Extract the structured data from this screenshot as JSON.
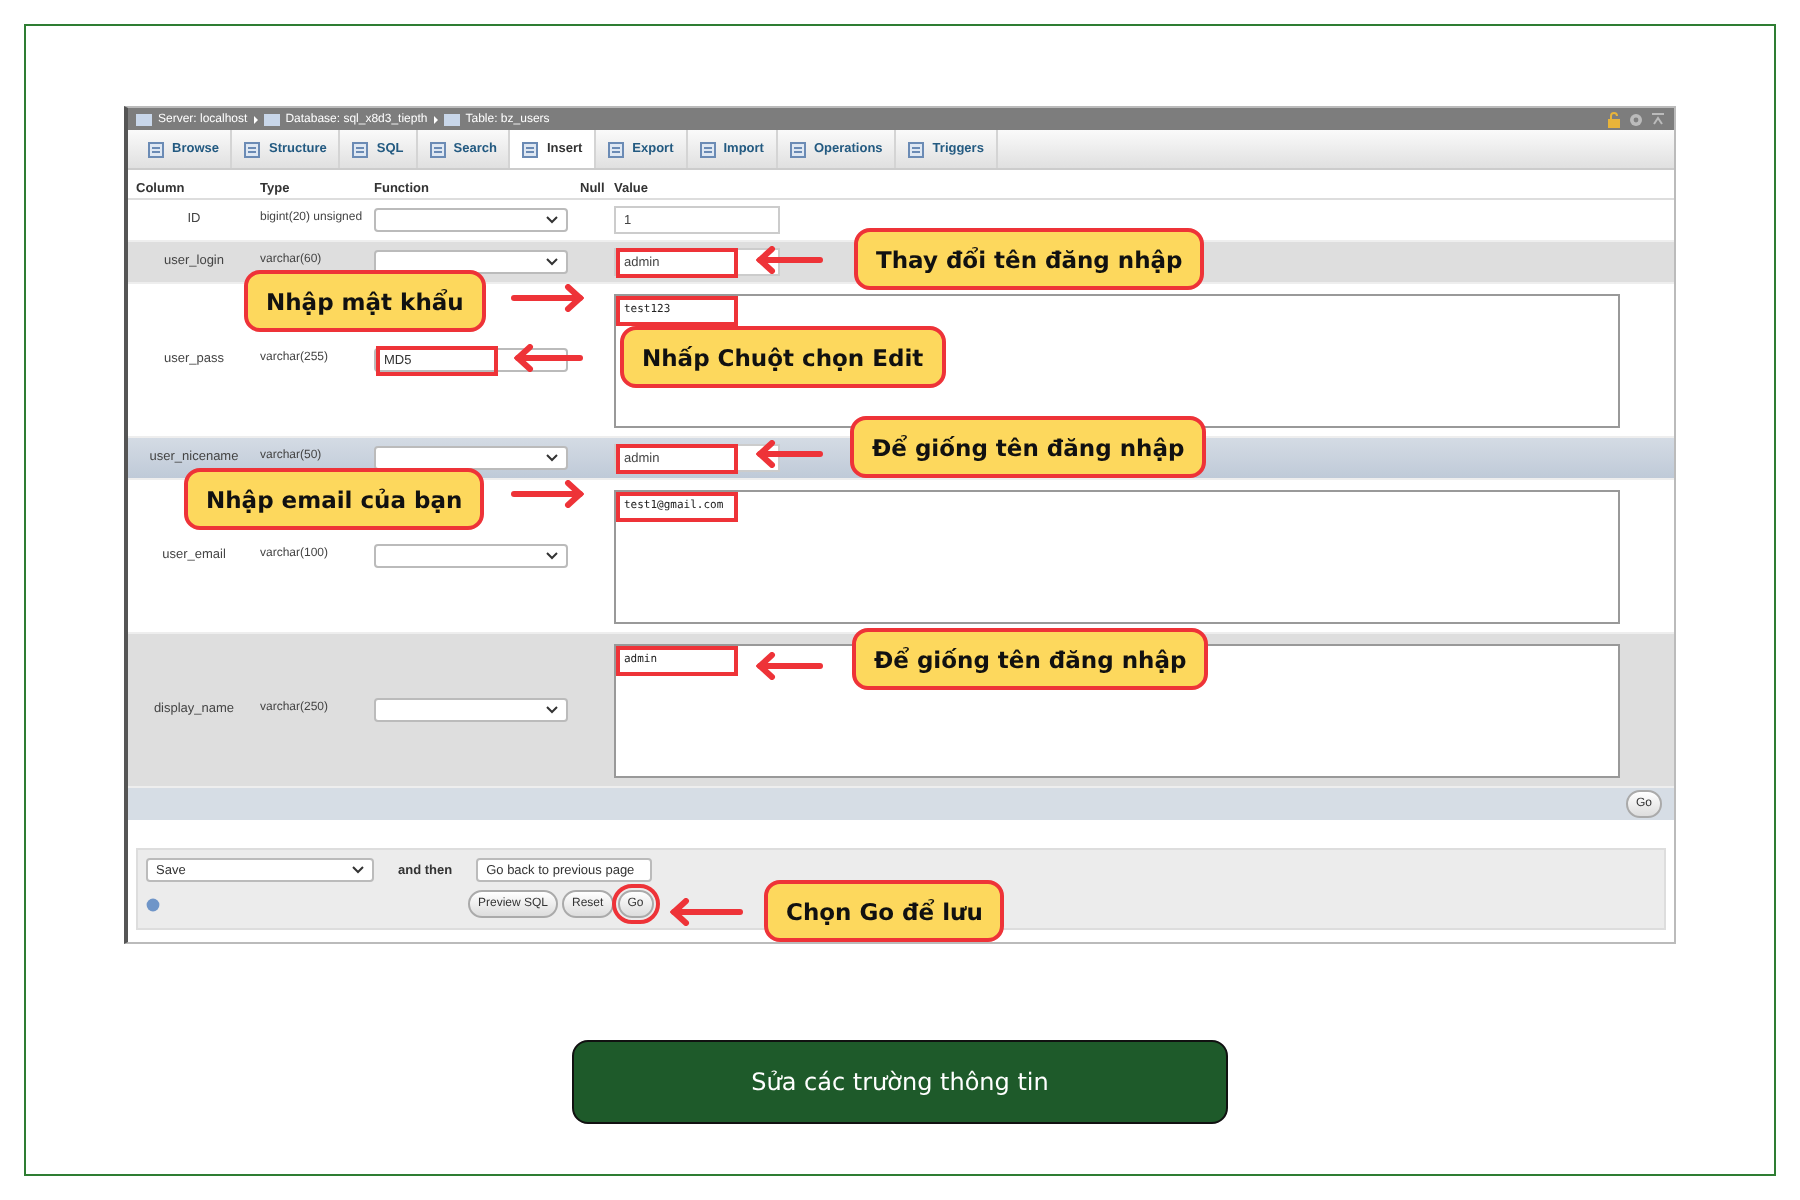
{
  "breadcrumb": [
    "Server: localhost",
    "Database: sql_x8d3_tiepth",
    "Table: bz_users"
  ],
  "tabs": [
    {
      "label": "Browse",
      "selected": false
    },
    {
      "label": "Structure",
      "selected": false
    },
    {
      "label": "SQL",
      "selected": false
    },
    {
      "label": "Search",
      "selected": false
    },
    {
      "label": "Insert",
      "selected": true
    },
    {
      "label": "Export",
      "selected": false
    },
    {
      "label": "Import",
      "selected": false
    },
    {
      "label": "Operations",
      "selected": false
    },
    {
      "label": "Triggers",
      "selected": false
    }
  ],
  "columns": [
    "Column",
    "Type",
    "Function",
    "Null",
    "Value"
  ],
  "rows": [
    {
      "column": "ID",
      "type": "bigint(20) unsigned",
      "kind": "plain",
      "function": {
        "kind": "select"
      },
      "value": {
        "kind": "input",
        "text": "1",
        "highlighted": false
      }
    },
    {
      "column": "user_login",
      "type": "varchar(60)",
      "kind": "grey",
      "function": {
        "kind": "select"
      },
      "value": {
        "kind": "input",
        "text": "admin",
        "highlighted": true
      }
    },
    {
      "column": "user_pass",
      "type": "varchar(255)",
      "kind": "plain",
      "function": {
        "kind": "text",
        "text": "MD5",
        "highlighted": true
      },
      "value": {
        "kind": "textarea",
        "text": "test123",
        "highlighted": true
      }
    },
    {
      "column": "user_nicename",
      "type": "varchar(50)",
      "kind": "marked",
      "function": {
        "kind": "select"
      },
      "value": {
        "kind": "input",
        "text": "admin",
        "highlighted": true
      }
    },
    {
      "column": "user_email",
      "type": "varchar(100)",
      "kind": "plain",
      "function": {
        "kind": "select"
      },
      "value": {
        "kind": "textarea",
        "text": "test1@gmail.com",
        "highlighted": true
      }
    },
    {
      "column": "display_name",
      "type": "varchar(250)",
      "kind": "grey",
      "function": {
        "kind": "select"
      },
      "value": {
        "kind": "textarea",
        "text": "admin",
        "highlighted": true
      }
    }
  ],
  "row_go_button": "Go",
  "footer": {
    "action": "Save",
    "and_then": "and then",
    "next": "Go back to previous page",
    "buttons": [
      {
        "label": "Preview SQL",
        "highlighted": false
      },
      {
        "label": "Reset",
        "highlighted": false
      },
      {
        "label": "Go",
        "highlighted": true
      }
    ]
  },
  "callouts": [
    "Thay đổi tên đăng nhập",
    "Nhập mật khẩu",
    "Nhấp Chuột chọn Edit",
    "Để giống tên đăng nhập",
    "Nhập email của bạn",
    "Để giống tên đăng nhập",
    "Chọn Go để lưu"
  ],
  "caption": "Sửa các trường thông tin"
}
